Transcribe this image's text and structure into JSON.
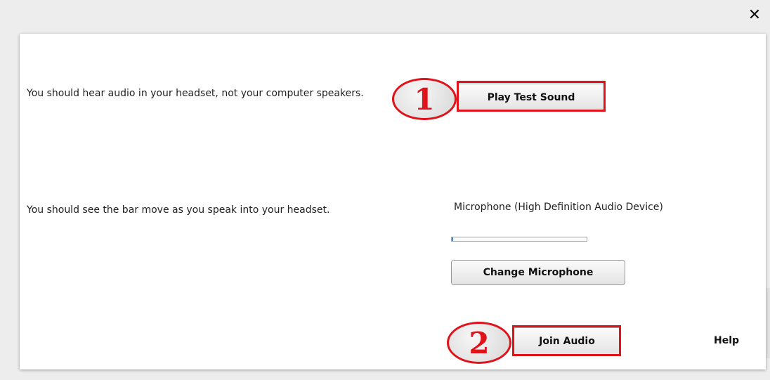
{
  "dialog": {
    "close_icon": "✕",
    "speaker_test": {
      "description": "You should hear audio in your headset, not your computer speakers.",
      "step_number": "1",
      "button_label": "Play Test Sound"
    },
    "mic_test": {
      "description": "You should see the bar move as you speak into your headset.",
      "device_name": "Microphone (High Definition Audio Device)",
      "level": 0.01,
      "change_button_label": "Change Microphone"
    },
    "footer": {
      "step_number": "2",
      "join_button_label": "Join Audio",
      "help_label": "Help"
    }
  },
  "colors": {
    "highlight": "#e0121a",
    "level_fill": "#4c8ac6"
  }
}
